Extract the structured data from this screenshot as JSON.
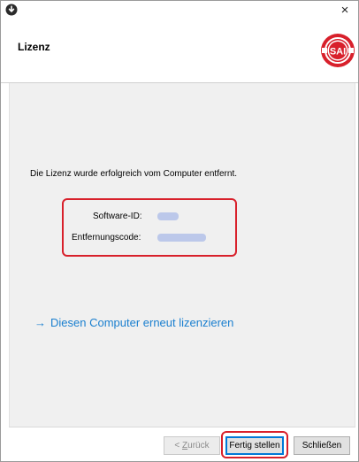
{
  "window": {
    "close_glyph": "×",
    "icon": "download-circle-icon"
  },
  "header": {
    "title": "Lizenz",
    "logo_text": "SAI",
    "logo_color": "#d8202b"
  },
  "content": {
    "message": "Die Lizenz wurde erfolgreich vom Computer entfernt.",
    "fields": {
      "software_id_label": "Software-ID:",
      "removal_code_label": "Entfernungscode:"
    },
    "highlight_color": "#d8202b",
    "relicense_arrow": "→",
    "relicense_link": "Diesen Computer erneut lizenzieren",
    "link_color": "#1a7fcf"
  },
  "footer": {
    "back_prefix": "< ",
    "back_underlined": "Z",
    "back_rest": "urück",
    "finish_label": "Fertig stellen",
    "close_label": "Schließen"
  }
}
